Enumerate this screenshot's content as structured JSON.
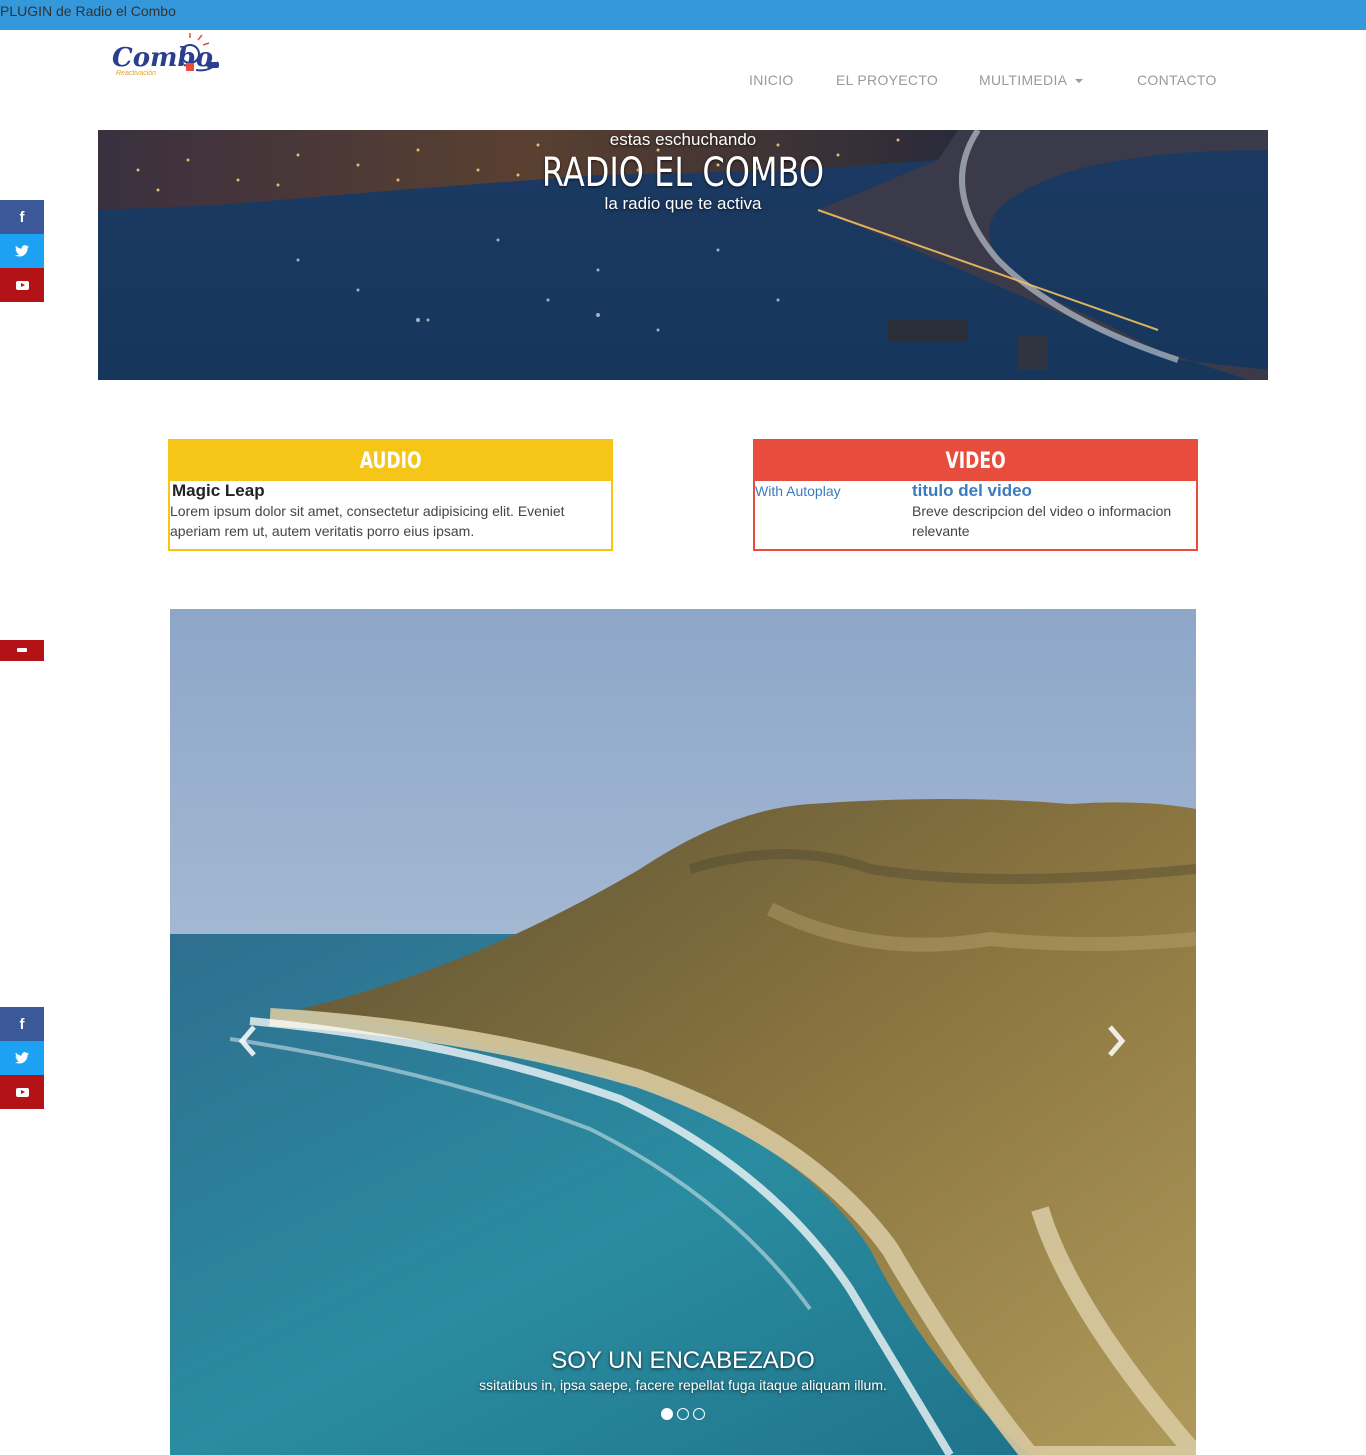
{
  "plugin_bar": {
    "text": "PLUGIN de Radio el Combo"
  },
  "logo": {
    "text": "Combo",
    "subtext": "Reactivación"
  },
  "nav": [
    {
      "label": "INICIO"
    },
    {
      "label": "EL PROYECTO"
    },
    {
      "label": "MULTIMEDIA",
      "has_dropdown": true
    },
    {
      "label": "CONTACTO"
    }
  ],
  "hero": {
    "pre": "estas eschuchando",
    "title": "RADIO EL COMBO",
    "subtitle": "la radio que te activa"
  },
  "social": {
    "facebook": "f",
    "twitter": "twitter-icon",
    "youtube": "youtube-icon"
  },
  "audio_panel": {
    "heading": "AUDIO",
    "title": "Magic Leap",
    "body": "Lorem ipsum dolor sit amet, consectetur adipisicing elit. Eveniet aperiam rem ut, autem veritatis porro eius ipsam."
  },
  "video_panel": {
    "heading": "VIDEO",
    "autoplay_label": "With Autoplay",
    "title": "titulo del video",
    "body": "Breve descripcion del video o informacion relevante"
  },
  "carousel": {
    "caption_title": "SOY UN ENCABEZADO",
    "caption_text": "ssitatibus in, ipsa saepe, facere repellat fuga itaque aliquam illum.",
    "slides": 3,
    "active_slide": 1
  },
  "colors": {
    "plugin_bar": "#3498db",
    "audio_accent": "#f5c518",
    "video_accent": "#e74c3c",
    "facebook": "#3b5998",
    "twitter": "#1da1f2",
    "youtube": "#b31217",
    "link": "#3a7bbf"
  }
}
